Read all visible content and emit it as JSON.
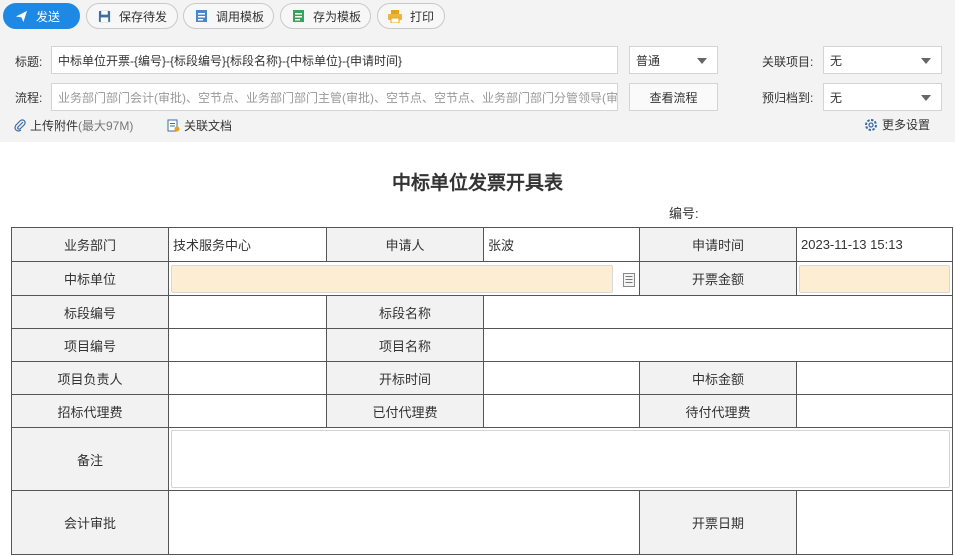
{
  "toolbar": {
    "send": "发送",
    "save_draft": "保存待发",
    "use_template": "调用模板",
    "save_template": "存为模板",
    "print": "打印"
  },
  "header": {
    "title_label": "标题:",
    "title_value": "中标单位开票-{编号}-{标段编号}{标段名称}-{中标单位}-{申请时间}",
    "priority": "普通",
    "related_project_label": "关联项目:",
    "related_project_value": "无",
    "flow_label": "流程:",
    "flow_value": "业务部门部门会计(审批)、空节点、业务部门部门主管(审批)、空节点、空节点、业务部门部门分管领导(审",
    "view_flow": "查看流程",
    "archive_label": "预归档到:",
    "archive_value": "无",
    "upload": "上传附件",
    "upload_hint": "(最大97M)",
    "related_doc": "关联文档",
    "more_settings": "更多设置"
  },
  "form": {
    "title": "中标单位发票开具表",
    "serial_label": "编号:",
    "labels": {
      "department": "业务部门",
      "applicant": "申请人",
      "apply_time": "申请时间",
      "winner": "中标单位",
      "invoice_amount": "开票金额",
      "section_no": "标段编号",
      "section_name": "标段名称",
      "project_no": "项目编号",
      "project_name": "项目名称",
      "project_lead": "项目负责人",
      "bid_open_time": "开标时间",
      "bid_amount": "中标金额",
      "agency_fee": "招标代理费",
      "paid_fee": "已付代理费",
      "pending_fee": "待付代理费",
      "remarks": "备注",
      "accounting": "会计审批",
      "invoice_date": "开票日期"
    },
    "values": {
      "department": "技术服务中心",
      "applicant": "张波",
      "apply_time": "2023-11-13 15:13"
    }
  },
  "colors": {
    "primary": "#1e88e5",
    "required_field": "#fdedd2",
    "label_bg": "#f2f2f2"
  }
}
